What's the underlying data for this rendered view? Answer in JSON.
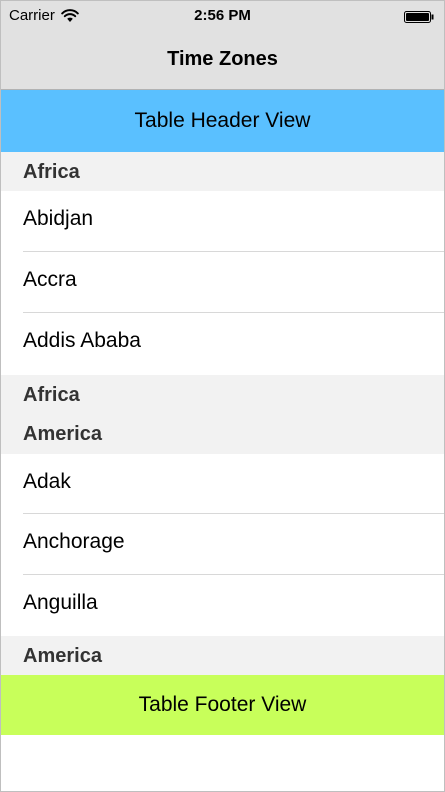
{
  "status_bar": {
    "carrier": "Carrier",
    "time": "2:56 PM",
    "wifi_icon": "wifi-icon",
    "battery_icon": "battery-icon"
  },
  "nav_bar": {
    "title": "Time Zones"
  },
  "table": {
    "header_view": "Table Header View",
    "footer_view": "Table Footer View",
    "sections": [
      {
        "header": "Africa",
        "rows": [
          "Abidjan",
          "Accra",
          "Addis Ababa"
        ],
        "footer": "Africa"
      },
      {
        "header": "America",
        "rows": [
          "Adak",
          "Anchorage",
          "Anguilla"
        ],
        "footer": "America"
      }
    ]
  },
  "colors": {
    "header_view_bg": "#5ac0ff",
    "footer_view_bg": "#c8ff5a",
    "section_bg": "#f2f2f2",
    "bar_bg": "#e1e1e1"
  }
}
